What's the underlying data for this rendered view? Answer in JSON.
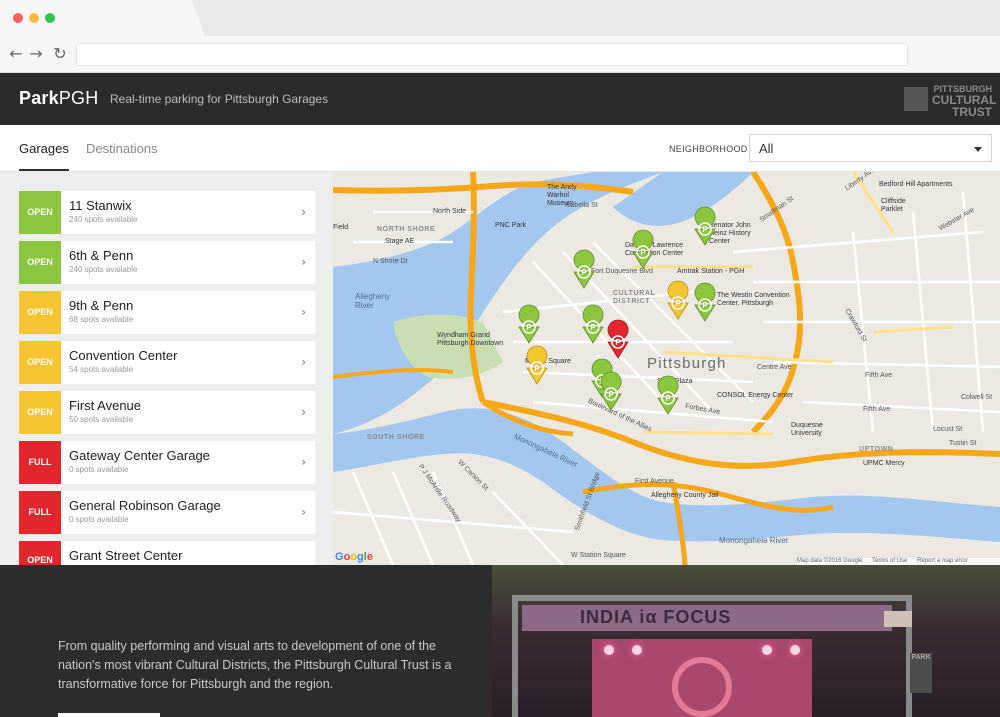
{
  "app": {
    "brand_prefix": "Park",
    "brand_suffix": "PGH",
    "tagline": "Real-time parking for Pittsburgh Garages",
    "sponsor_logo": {
      "line1": "PITTSBURGH",
      "line2": "CULTURAL",
      "line3": "TRUST"
    }
  },
  "tabs": [
    {
      "label": "Garages",
      "active": true
    },
    {
      "label": "Destinations",
      "active": false
    }
  ],
  "filter": {
    "label": "NEIGHBORHOOD",
    "value": "All"
  },
  "garages": [
    {
      "status": "OPEN",
      "status_color": "#8cc63f",
      "name": "11 Stanwix",
      "spots": "240 spots available"
    },
    {
      "status": "OPEN",
      "status_color": "#8cc63f",
      "name": "6th & Penn",
      "spots": "240 spots available"
    },
    {
      "status": "OPEN",
      "status_color": "#f7c531",
      "name": "9th & Penn",
      "spots": "68 spots available"
    },
    {
      "status": "OPEN",
      "status_color": "#f7c531",
      "name": "Convention Center",
      "spots": "54 spots available"
    },
    {
      "status": "OPEN",
      "status_color": "#f7c531",
      "name": "First Avenue",
      "spots": "50 spots available"
    },
    {
      "status": "FULL",
      "status_color": "#e3262d",
      "name": "Gateway Center Garage",
      "spots": "0 spots available"
    },
    {
      "status": "FULL",
      "status_color": "#e3262d",
      "name": "General Robinson Garage",
      "spots": "0 spots available"
    },
    {
      "status": "OPEN",
      "status_color": "#e3262d",
      "name": "Grant Street Center",
      "spots": ""
    }
  ],
  "map": {
    "city_label": "Pittsburgh",
    "google_label": "Google",
    "footer": [
      "Map data ©2016 Google",
      "Terms of Use",
      "Report a map error"
    ],
    "districts": [
      "NORTH SHORE",
      "CULTURAL DISTRICT",
      "SOUTH SHORE",
      "UPTOWN"
    ],
    "rivers": [
      "Allegheny River",
      "Monongahela River",
      "Monongahela River"
    ],
    "streets": [
      "North Side",
      "PNC Park",
      "Stage AE",
      "N Shore Dr",
      "The Andy Warhol Museum",
      "Isabella St",
      "Field",
      "David L. Lawrence Convention Center",
      "Fort Duquesne Blvd",
      "Amtrak Station - PGH",
      "Senator John Heinz History Center",
      "Smallman St",
      "Liberty Ave",
      "Bedford Hill Apartments",
      "Cliffside Parklet",
      "Webster Ave",
      "Wyndham Grand Pittsburgh Downtown",
      "The Westin Convention Center, Pittsburgh",
      "Market Square",
      "Fifth Ave",
      "Steel Plaza",
      "CONSOL Energy Center",
      "Forbes Ave",
      "Boulevard of the Allies",
      "Duquesne University",
      "UPMC Mercy",
      "First Avenue",
      "Allegheny County Jail",
      "W Carson St",
      "P J McArdle Roadway",
      "Smithfield St Bridge",
      "W Station Square",
      "Centre Ave",
      "Crawford St",
      "Fifth Ave",
      "Colwell St",
      "Locust St",
      "Tustin St"
    ],
    "pins": [
      {
        "color": "#8cc63f",
        "letter": "P"
      },
      {
        "color": "#8cc63f",
        "letter": "P"
      },
      {
        "color": "#8cc63f",
        "letter": "P"
      },
      {
        "color": "#f7c531",
        "letter": "P"
      },
      {
        "color": "#8cc63f",
        "letter": "P"
      },
      {
        "color": "#8cc63f",
        "letter": "P"
      },
      {
        "color": "#8cc63f",
        "letter": "P"
      },
      {
        "color": "#e3262d",
        "letter": "P"
      },
      {
        "color": "#f7c531",
        "letter": "P"
      },
      {
        "color": "#8cc63f",
        "letter": "P"
      },
      {
        "color": "#8cc63f",
        "letter": "P"
      },
      {
        "color": "#8cc63f",
        "letter": "P"
      }
    ]
  },
  "promo": {
    "text": "From quality performing and visual arts to development of one of the nation's most vibrant Cultural Districts, the Pittsburgh Cultural Trust is a transformative force for Pittsburgh and the region.",
    "banner_text": "INDIA iα FOCUS",
    "park_sign": "PARK"
  },
  "colors": {
    "header_bg": "#2b2b2b",
    "open_green": "#8cc63f",
    "open_yellow": "#f7c531",
    "full_red": "#e3262d",
    "water": "#a3c7ee",
    "highway": "#f8a718"
  }
}
